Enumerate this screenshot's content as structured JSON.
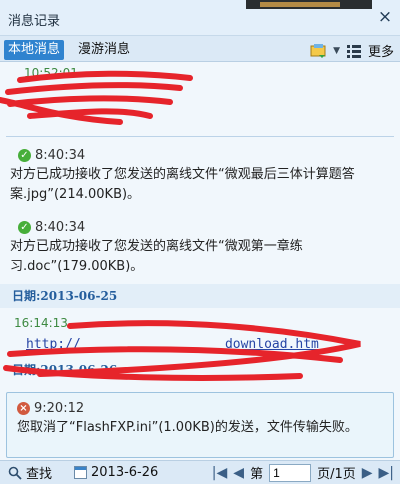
{
  "window": {
    "title": "消息记录",
    "close_label": "×"
  },
  "tabs": {
    "local": "本地消息",
    "roam": "漫游消息",
    "more": "更多"
  },
  "messages": [
    {
      "time": "8:40:34",
      "text": "对方已成功接收了您发送的离线文件“微观最后三体计算题答案.jpg”(214.00KB)。"
    },
    {
      "time": "8:40:34",
      "text": "对方已成功接收了您发送的离线文件“微观第一章练习.doc”(179.00KB)。"
    }
  ],
  "dates": {
    "d1": "日期:2013-06-25",
    "d2": "日期:2013-06-26"
  },
  "partial": {
    "top_time": "10:52:01",
    "mid_sender_time": "16:14:13",
    "link_text": "http://",
    "link_tail": "download.htm"
  },
  "error_msg": {
    "time": "9:20:12",
    "text": "您取消了“FlashFXP.ini”(1.00KB)的发送，文件传输失败。"
  },
  "bottom": {
    "find": "查找",
    "date": "2013-6-26",
    "page_prefix": "第",
    "page_value": "1",
    "page_suffix": "页/1页"
  }
}
